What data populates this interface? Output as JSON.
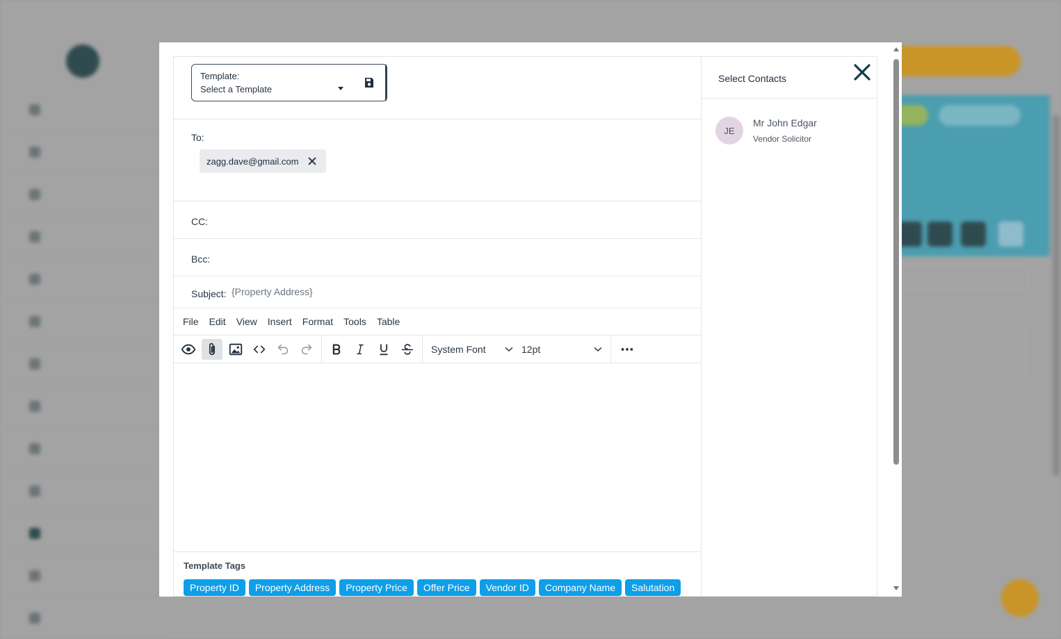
{
  "modal": {
    "template": {
      "label": "Template:",
      "value": "Select a Template"
    },
    "to": {
      "label": "To:",
      "recipients": [
        "zagg.dave@gmail.com"
      ]
    },
    "cc": {
      "label": "CC:"
    },
    "bcc": {
      "label": "Bcc:"
    },
    "subject": {
      "label": "Subject:",
      "value": "{Property Address}"
    },
    "menu": [
      "File",
      "Edit",
      "View",
      "Insert",
      "Format",
      "Tools",
      "Table"
    ],
    "toolbar": {
      "font_family": "System Font",
      "font_size": "12pt"
    },
    "template_tags": {
      "title": "Template Tags",
      "tags": [
        "Property ID",
        "Property Address",
        "Property Price",
        "Offer Price",
        "Vendor ID",
        "Company Name",
        "Salutation"
      ]
    },
    "contacts": {
      "title": "Select Contacts",
      "items": [
        {
          "initials": "JE",
          "name": "Mr John Edgar",
          "role": "Vendor Solicitor"
        }
      ]
    }
  }
}
